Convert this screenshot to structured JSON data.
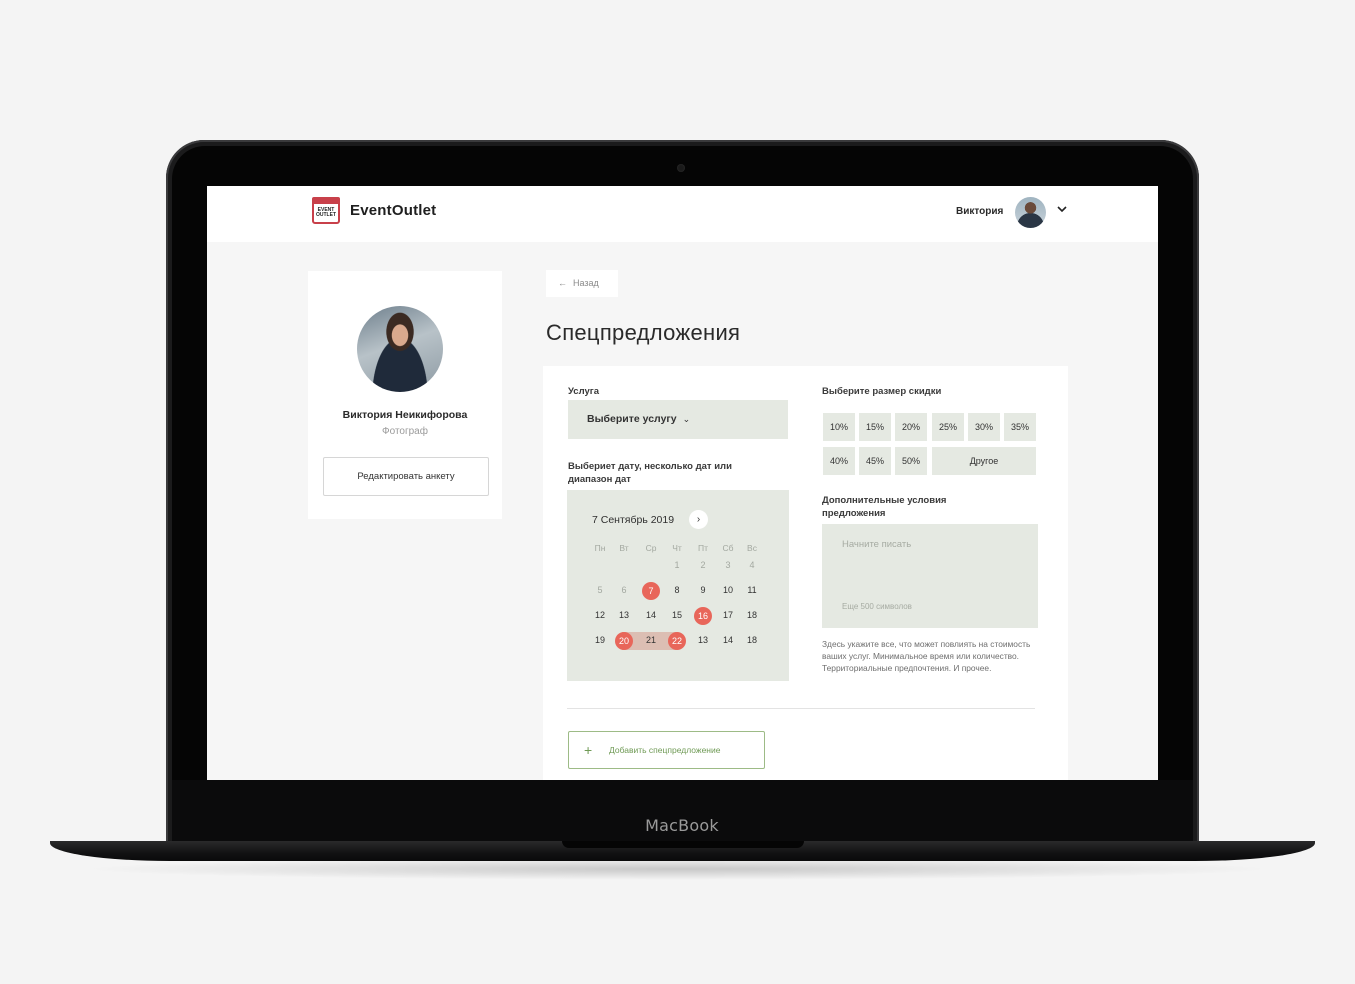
{
  "device": {
    "brand": "MacBook"
  },
  "header": {
    "logo_line1": "EVENT",
    "logo_line2": "OUTLET",
    "logo_text": "EventOutlet",
    "user_name": "Виктория"
  },
  "profile": {
    "name": "Виктория Неикифорова",
    "role": "Фотограф",
    "edit_label": "Редактировать анкету"
  },
  "main": {
    "back_label": "Назад",
    "title": "Спецпредложения"
  },
  "form": {
    "service_label": "Услуга",
    "service_placeholder": "Выберите услугу",
    "dates_label_line1": "Выбериет дату, несколько дат или",
    "dates_label_line2": "диапазон дат",
    "calendar": {
      "month": "7 Сентябрь 2019",
      "weekdays": [
        "Пн",
        "Вт",
        "Ср",
        "Чт",
        "Пт",
        "Сб",
        "Вс"
      ],
      "rows": [
        [
          "",
          "",
          "",
          "1",
          "2",
          "3",
          "4"
        ],
        [
          "5",
          "6",
          "7",
          "8",
          "9",
          "10",
          "11"
        ],
        [
          "12",
          "13",
          "14",
          "15",
          "16",
          "17",
          "18"
        ],
        [
          "19",
          "20",
          "21",
          "22",
          "13",
          "14",
          "18"
        ]
      ],
      "selected": [
        "7",
        "16",
        "20",
        "22"
      ]
    },
    "discount_label": "Выберите размер скидки",
    "discounts": [
      "10%",
      "15%",
      "20%",
      "25%",
      "30%",
      "35%",
      "40%",
      "45%",
      "50%",
      "Другое"
    ],
    "conditions_label_line1": "Дополнительные условия",
    "conditions_label_line2": "предложения",
    "conditions_placeholder": "Начните писать",
    "conditions_counter": "Еще 500 символов",
    "conditions_hint": "Здесь укажите все, что может повлиять на стоимость ваших услуг. Минимальное время или количество.  Территориальные предпочтения. И прочее.",
    "add_label": "Добавить спецпредложение"
  },
  "colors": {
    "accent_green": "#6f9a55",
    "selected_date": "#e8665a",
    "panel": "#e5e9e2",
    "logo_red": "#c8404a"
  }
}
